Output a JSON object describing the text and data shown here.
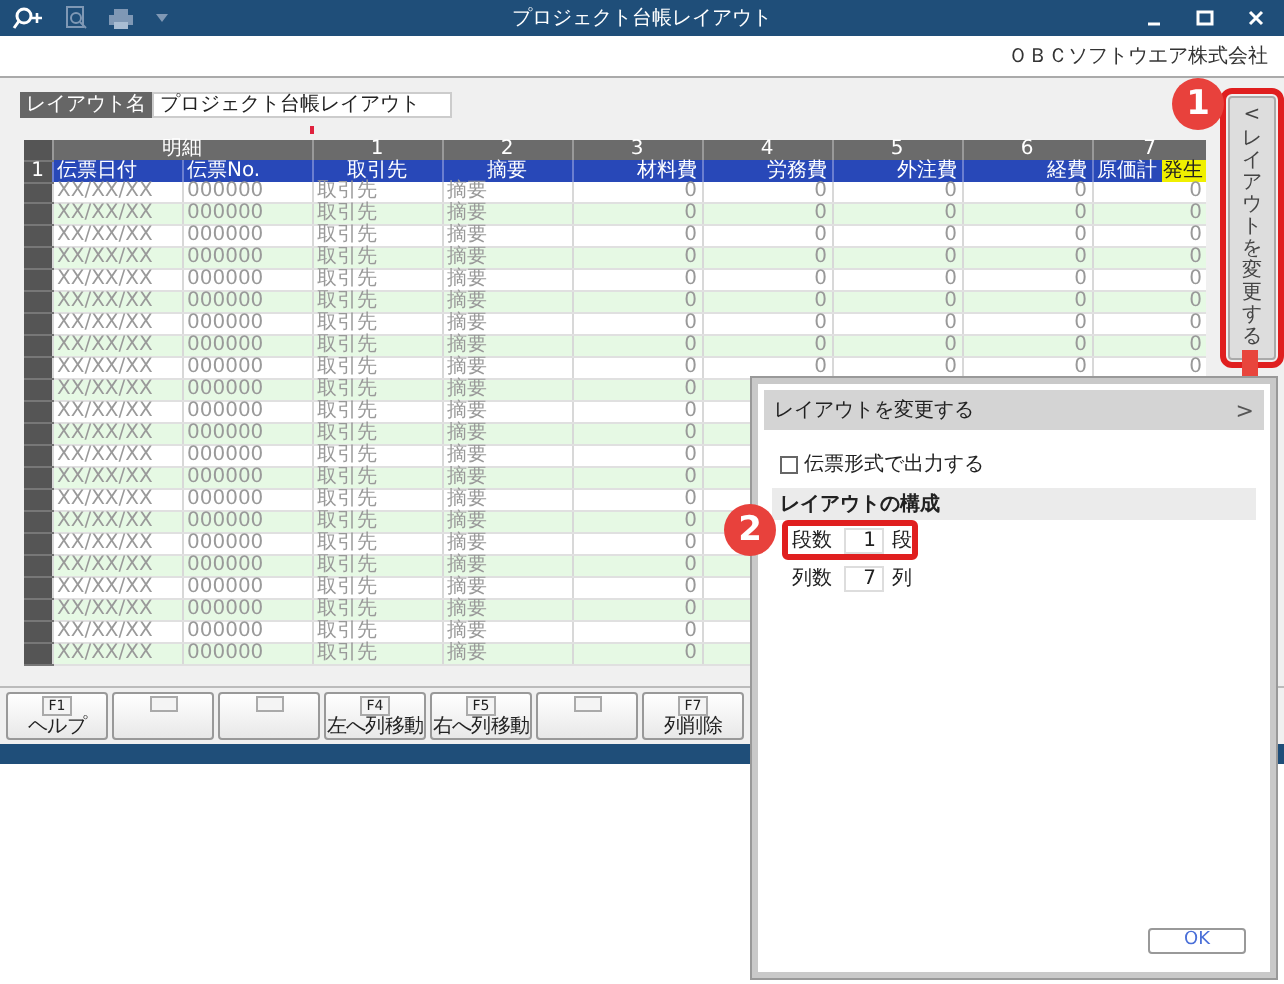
{
  "window": {
    "title": "プロジェクト台帳レイアウト"
  },
  "company": "ＯＢＣソフトウエア株式会社",
  "layout_name": {
    "label": "レイアウト名",
    "value": "プロジェクト台帳レイアウト"
  },
  "table": {
    "group_headers": [
      {
        "label": "明細"
      },
      {
        "label": "1"
      },
      {
        "label": "2"
      },
      {
        "label": "3"
      },
      {
        "label": "4"
      },
      {
        "label": "5"
      },
      {
        "label": "6"
      },
      {
        "label": "7"
      }
    ],
    "row_number": "1",
    "columns": [
      {
        "label": "伝票日付",
        "kind": "text"
      },
      {
        "label": "伝票No.",
        "kind": "text"
      },
      {
        "label": "取引先",
        "kind": "text"
      },
      {
        "label": "摘要",
        "kind": "text"
      },
      {
        "label": "材料費",
        "kind": "number"
      },
      {
        "label": "労務費",
        "kind": "number"
      },
      {
        "label": "外注費",
        "kind": "number"
      },
      {
        "label": "経費",
        "kind": "number"
      },
      {
        "label": "原価計",
        "kind": "number",
        "badge": "発生"
      }
    ],
    "rows": [
      [
        "XX/XX/XX",
        "000000",
        "取引先",
        "摘要",
        "0",
        "0",
        "0",
        "0",
        "0"
      ],
      [
        "XX/XX/XX",
        "000000",
        "取引先",
        "摘要",
        "0",
        "0",
        "0",
        "0",
        "0"
      ],
      [
        "XX/XX/XX",
        "000000",
        "取引先",
        "摘要",
        "0",
        "0",
        "0",
        "0",
        "0"
      ],
      [
        "XX/XX/XX",
        "000000",
        "取引先",
        "摘要",
        "0",
        "0",
        "0",
        "0",
        "0"
      ],
      [
        "XX/XX/XX",
        "000000",
        "取引先",
        "摘要",
        "0",
        "0",
        "0",
        "0",
        "0"
      ],
      [
        "XX/XX/XX",
        "000000",
        "取引先",
        "摘要",
        "0",
        "0",
        "0",
        "0",
        "0"
      ],
      [
        "XX/XX/XX",
        "000000",
        "取引先",
        "摘要",
        "0",
        "0",
        "0",
        "0",
        "0"
      ],
      [
        "XX/XX/XX",
        "000000",
        "取引先",
        "摘要",
        "0",
        "0",
        "0",
        "0",
        "0"
      ],
      [
        "XX/XX/XX",
        "000000",
        "取引先",
        "摘要",
        "0",
        "0",
        "0",
        "0",
        "0"
      ],
      [
        "XX/XX/XX",
        "000000",
        "取引先",
        "摘要",
        "0"
      ],
      [
        "XX/XX/XX",
        "000000",
        "取引先",
        "摘要",
        "0"
      ],
      [
        "XX/XX/XX",
        "000000",
        "取引先",
        "摘要",
        "0"
      ],
      [
        "XX/XX/XX",
        "000000",
        "取引先",
        "摘要",
        "0"
      ],
      [
        "XX/XX/XX",
        "000000",
        "取引先",
        "摘要",
        "0"
      ],
      [
        "XX/XX/XX",
        "000000",
        "取引先",
        "摘要",
        "0"
      ],
      [
        "XX/XX/XX",
        "000000",
        "取引先",
        "摘要",
        "0"
      ],
      [
        "XX/XX/XX",
        "000000",
        "取引先",
        "摘要",
        "0"
      ],
      [
        "XX/XX/XX",
        "000000",
        "取引先",
        "摘要",
        "0"
      ],
      [
        "XX/XX/XX",
        "000000",
        "取引先",
        "摘要",
        "0"
      ],
      [
        "XX/XX/XX",
        "000000",
        "取引先",
        "摘要",
        "0"
      ],
      [
        "XX/XX/XX",
        "000000",
        "取引先",
        "摘要",
        "0"
      ],
      [
        "XX/XX/XX",
        "000000",
        "取引先",
        "摘要",
        "0"
      ]
    ]
  },
  "side_tab": {
    "arrow": "<",
    "label": "レイアウトを変更する",
    "highlighted": true
  },
  "function_keys": [
    {
      "kind": "key",
      "key": "F1",
      "label": "ヘルプ"
    },
    {
      "kind": "blank"
    },
    {
      "kind": "blank"
    },
    {
      "kind": "key",
      "key": "F4",
      "label": "左へ列移動"
    },
    {
      "kind": "key",
      "key": "F5",
      "label": "右へ列移動"
    },
    {
      "kind": "blank"
    },
    {
      "kind": "key",
      "key": "F7",
      "label": "列削除"
    }
  ],
  "panel": {
    "title": "レイアウトを変更する",
    "collapse": ">",
    "checkbox": {
      "label": "伝票形式で出力する",
      "checked": false
    },
    "section": "レイアウトの構成",
    "fields": [
      {
        "label": "段数",
        "value": "1",
        "unit": "段",
        "highlighted": true
      },
      {
        "label": "列数",
        "value": "7",
        "unit": "列"
      }
    ],
    "ok": "OK"
  },
  "annotations": [
    {
      "label": "1"
    },
    {
      "label": "2"
    }
  ]
}
